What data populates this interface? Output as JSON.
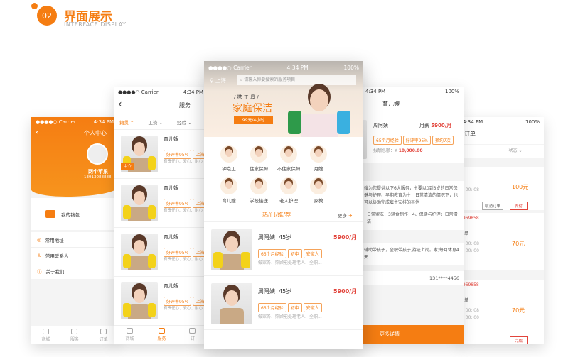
{
  "header": {
    "number": "02",
    "title": "界面展示",
    "subtitle": "INTERFACE DISPLAY"
  },
  "colors": {
    "accent": "#f57d12",
    "price": "#e2443b"
  },
  "status": {
    "carrier": "●●●●○ Carrier",
    "time": "4:34 PM",
    "battery": "100%"
  },
  "profile": {
    "title": "个人中心",
    "name": "两个苹果",
    "phone": "13913088888",
    "wallet": "我的钱包",
    "menu": [
      "常用地址",
      "常用联系人",
      "关于我们"
    ],
    "tabs": [
      "商城",
      "服务",
      "订单"
    ]
  },
  "service": {
    "title": "服务",
    "filters": [
      "籍贯",
      "工资",
      "经验"
    ],
    "badge": "中介",
    "items": [
      {
        "name": "育儿嫂",
        "tags": [
          "好评率95%",
          "上海"
        ],
        "desc": "有责任心、爱心、耐心"
      },
      {
        "name": "育儿嫂",
        "tags": [
          "好评率95%",
          "上海"
        ],
        "desc": "有责任心、爱心、耐心"
      },
      {
        "name": "育儿嫂",
        "tags": [
          "好评率95%",
          "上海"
        ],
        "desc": "有责任心、爱心、耐心"
      },
      {
        "name": "育儿嫂",
        "tags": [
          "好评率95%",
          "上海"
        ],
        "desc": "有责任心、爱心、耐心"
      }
    ],
    "tabs": [
      "商城",
      "服务",
      "订"
    ]
  },
  "home": {
    "city": "上海",
    "search_placeholder": "请输入你要搜索的服务项目",
    "banner_kicker": "/·携 工 具·/",
    "banner_title": "家庭保洁",
    "banner_price": "99元/4小时",
    "categories": [
      "钟点工",
      "住家保姆",
      "不住家保姆",
      "月嫂",
      "育儿嫂",
      "学校接送",
      "老人护理",
      "家教"
    ],
    "section": "热/门/推/荐",
    "more": "更多",
    "workers": [
      {
        "name": "周阿姨",
        "age": "45岁",
        "price": "5900/月",
        "tags": [
          "65个月经验",
          "初中",
          "安徽人"
        ],
        "desc": "做家务、照顾能处理老人、全职..."
      },
      {
        "name": "周阿姨",
        "age": "45岁",
        "price": "5900/月",
        "tags": [
          "65个月经验",
          "初中",
          "安徽人"
        ],
        "desc": "做家务、照顾能处理老人、全职..."
      }
    ]
  },
  "detail": {
    "title": "育儿嫂",
    "name": "周阿姨",
    "salary_label": "月薪",
    "salary": "5900/月",
    "tags": [
      "65个月经验",
      "好评率95%",
      "预约7次"
    ],
    "total_label": "报酬总额：¥",
    "total": "10,000.00",
    "para1": "嫂为您提供以下6大服务，主要以0到3岁的日常保健与护理、早期教育为主，日常清洁的情况下，也可以协助完成雇主安排的其他",
    "para2": "日常盥洗；3辅食制作；4、保健与护理；日常清洁",
    "para3": "辅助带孩子，全职带孩子,持证上岗。家;每月休息4天......",
    "phone": "131****4456",
    "more_button": "更多详情"
  },
  "orders": {
    "title": "订单",
    "filter": "状态",
    "items": [
      {
        "time1": "8: 00: 08",
        "price": "100元",
        "buttons": [
          "取消订单",
          "支付"
        ]
      },
      {
        "phone": "6969858",
        "title": "订单",
        "time1": "8: 00: 08",
        "time2": "0: 00: 00",
        "price": "70元"
      },
      {
        "phone": "6969858",
        "title": "订单",
        "time1": "8: 00: 08",
        "time2": "0: 00: 00",
        "price": "70元",
        "buttons": [
          "完成"
        ]
      }
    ]
  }
}
